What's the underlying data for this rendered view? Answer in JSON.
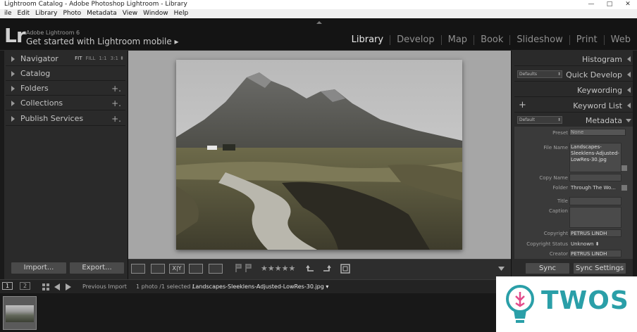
{
  "window": {
    "title": "Lightroom Catalog - Adobe Photoshop Lightroom - Library",
    "controls": [
      "—",
      "□",
      "✕"
    ]
  },
  "menu": [
    "ile",
    "Edit",
    "Library",
    "Photo",
    "Metadata",
    "View",
    "Window",
    "Help"
  ],
  "identity": {
    "logo": "Lr",
    "app_name": "Adobe Lightroom 6",
    "promo": "Get started with Lightroom mobile ▸"
  },
  "modules": [
    {
      "label": "Library",
      "active": true
    },
    {
      "label": "Develop",
      "active": false
    },
    {
      "label": "Map",
      "active": false
    },
    {
      "label": "Book",
      "active": false
    },
    {
      "label": "Slideshow",
      "active": false
    },
    {
      "label": "Print",
      "active": false
    },
    {
      "label": "Web",
      "active": false
    }
  ],
  "left_panel": {
    "navigator": {
      "label": "Navigator",
      "zoom": [
        "FIT",
        "FILL",
        "1:1",
        "3:1 ⬍"
      ]
    },
    "sections": [
      {
        "label": "Catalog",
        "plus": ""
      },
      {
        "label": "Folders",
        "plus": "+."
      },
      {
        "label": "Collections",
        "plus": "+."
      },
      {
        "label": "Publish Services",
        "plus": "+."
      }
    ],
    "import_label": "Import...",
    "export_label": "Export..."
  },
  "toolbar": {
    "view_icons": [
      "grid-view-icon",
      "loupe-view-icon",
      "compare-view-icon",
      "survey-view-icon",
      "people-view-icon"
    ],
    "compare_label": "X|Y",
    "stars": "★★★★★",
    "rating": 0
  },
  "right_panel": {
    "histogram": "Histogram",
    "quick_develop": {
      "label": "Quick Develop",
      "preset": "Defaults"
    },
    "keywording": "Keywording",
    "keyword_list": {
      "label": "Keyword List",
      "plus": "+"
    },
    "metadata": {
      "label": "Metadata",
      "preset": "Default"
    },
    "fields": {
      "preset_key": "Preset",
      "preset_val": "None",
      "file_name_key": "File Name",
      "file_name_val": "Landscapes-Sleeklens-Adjusted-LowRes-30.jpg",
      "copy_name_key": "Copy Name",
      "folder_key": "Folder",
      "folder_val": "Through The Wo...",
      "title_key": "Title",
      "caption_key": "Caption",
      "copyright_key": "Copyright",
      "copyright_val": "PETRUS LINDH",
      "copyright_status_key": "Copyright Status",
      "copyright_status_val": "Unknown ⬍",
      "creator_key": "Creator",
      "creator_val": "PETRUS LINDH"
    },
    "sync_label": "Sync",
    "sync_settings_label": "Sync Settings"
  },
  "filmstrip_bar": {
    "monitor1": "1",
    "monitor2": "2",
    "source": "Previous Import",
    "count": "1 photo /1 selected /",
    "file": "Landscapes-Sleeklens-Adjusted-LowRes-30.jpg ▾"
  },
  "watermark": "TWOS",
  "colors": {
    "accent": "#2a9fa8",
    "panel": "#2a2a2a",
    "background": "#a6a6a6"
  }
}
